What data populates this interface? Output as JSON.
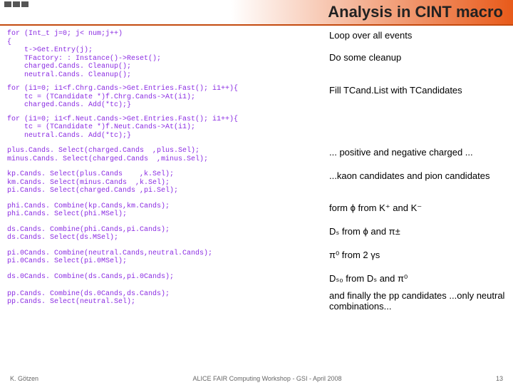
{
  "title": "Analysis in CINT macro",
  "blocks": [
    {
      "code": "for (Int_t j=0; j< num;j++)\n{\n    t->Get.Entry(j);\n    TFactory: : Instance()->Reset();\n    charged.Cands. Cleanup();\n    neutral.Cands. Cleanup();",
      "ann": "Loop over all events",
      "ann2": "Do some cleanup",
      "bracketTop": 42,
      "bracketH": 72,
      "bracketLeft": 228,
      "annTop": 48,
      "ann2Top": 82
    },
    {
      "code": "for (i1=0; i1<f.Chrg.Cands->Get.Entries.Fast(); i1++){\n    tc = (TCandidate *)f.Chrg.Cands->At(i1);\n    charged.Cands. Add(*tc);}",
      "ann": "Fill TCand.List with TCandidates",
      "bracketTop": 154,
      "bracketH": 70,
      "bracketLeft": 350,
      "annTop": 158
    },
    {
      "code": "for (i1=0; i1<f.Neut.Cands->Get.Entries.Fast(); i1++){\n    tc = (TCandidate *)f.Neut.Cands->At(i1);\n    neutral.Cands. Add(*tc);}",
      "ann": "",
      "annTop": 0
    },
    {
      "code": "plus.Cands. Select(charged.Cands  ,plus.Sel);\nminus.Cands. Select(charged.Cands  ,minus.Sel);",
      "ann": "... positive and negative charged ...",
      "bracketTop": 230,
      "bracketH": 22,
      "bracketLeft": 298,
      "annTop": 230
    },
    {
      "code": "kp.Cands. Select(plus.Cands    ,k.Sel);\nkm.Cands. Select(minus.Cands  ,k.Sel);\npi.Cands. Select(charged.Cands ,pi.Sel);",
      "ann": "...kaon candidates and pion candidates",
      "bracketTop": 262,
      "bracketH": 34,
      "bracketLeft": 264,
      "annTop": 264
    },
    {
      "code": "phi.Cands. Combine(kp.Cands,km.Cands);\nphi.Cands. Select(phi.MSel);",
      "ann": "form ϕ from K⁺ and K⁻",
      "bracketTop": 306,
      "bracketH": 22,
      "bracketLeft": 256,
      "annTop": 308
    },
    {
      "code": "ds.Cands. Combine(phi.Cands,pi.Cands);\nds.Cands. Select(ds.MSel);",
      "ann": "Dₛ from ϕ and π±",
      "bracketTop": 338,
      "bracketH": 22,
      "bracketLeft": 256,
      "annTop": 340
    },
    {
      "code": "pi.0Cands. Combine(neutral.Cands,neutral.Cands);\npi.0Cands. Select(pi.0MSel);",
      "ann": "π⁰ from 2 γs",
      "bracketTop": 370,
      "bracketH": 22,
      "bracketLeft": 310,
      "annTop": 372
    },
    {
      "code": "ds.0Cands. Combine(ds.Cands,pi.0Cands);",
      "ann": "Dₛ₀ from Dₛ and π⁰",
      "bracketTop": 402,
      "bracketH": 12,
      "bracketLeft": 262,
      "annTop": 402
    },
    {
      "code": "pp.Cands. Combine(ds.0Cands,ds.Cands);\npp.Cands. Select(neutral.Sel);",
      "ann": "and finally the pp candidates ...only neutral combinations...",
      "bracketTop": 426,
      "bracketH": 22,
      "bracketLeft": 256,
      "annTop": 424
    }
  ],
  "footer": {
    "left": "K. Götzen",
    "center": "ALICE FAIR Computing Workshop - GSI - April 2008",
    "right": "13"
  }
}
